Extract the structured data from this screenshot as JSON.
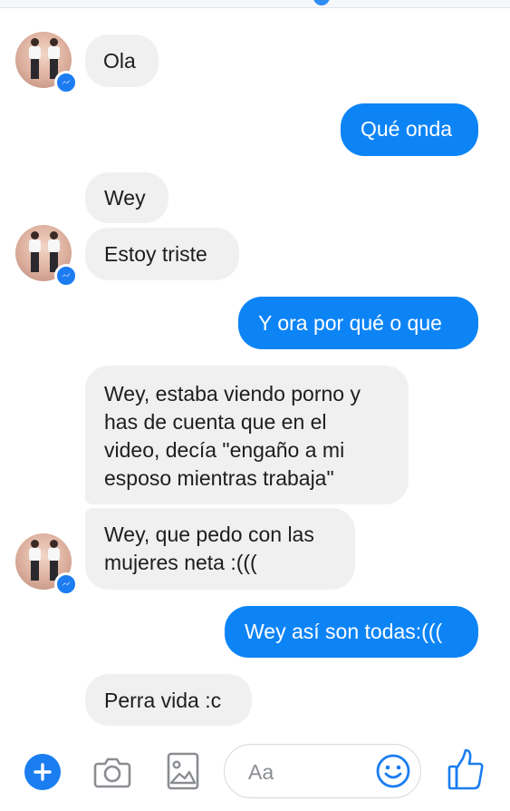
{
  "conversation": {
    "messages": [
      {
        "text": "Ola",
        "direction": "incoming"
      },
      {
        "text": "Qué onda",
        "direction": "outgoing"
      },
      {
        "text": "Wey",
        "direction": "incoming"
      },
      {
        "text": "Estoy triste",
        "direction": "incoming"
      },
      {
        "text": "Y ora por qué o que",
        "direction": "outgoing"
      },
      {
        "lines": [
          "Wey, estaba viendo porno y",
          "has de cuenta que en el",
          "video, decía \"engaño a mi",
          "esposo mientras trabaja\""
        ],
        "direction": "incoming"
      },
      {
        "lines": [
          "Wey, que pedo con las",
          "mujeres neta :((("
        ],
        "direction": "incoming"
      },
      {
        "text": "Wey así son todas:(((",
        "direction": "outgoing"
      },
      {
        "text": "Perra vida :c",
        "direction": "incoming"
      }
    ]
  },
  "composer": {
    "placeholder": "Aa"
  },
  "colors": {
    "accent": "#0d84f6",
    "incoming_bubble": "#f0f0f0",
    "outgoing_text": "#ffffff"
  },
  "icons": {
    "add": "plus-icon",
    "camera": "camera-icon",
    "gallery": "gallery-icon",
    "emoji": "emoji-icon",
    "like": "thumbs-up-icon",
    "messenger_badge": "messenger-icon"
  }
}
